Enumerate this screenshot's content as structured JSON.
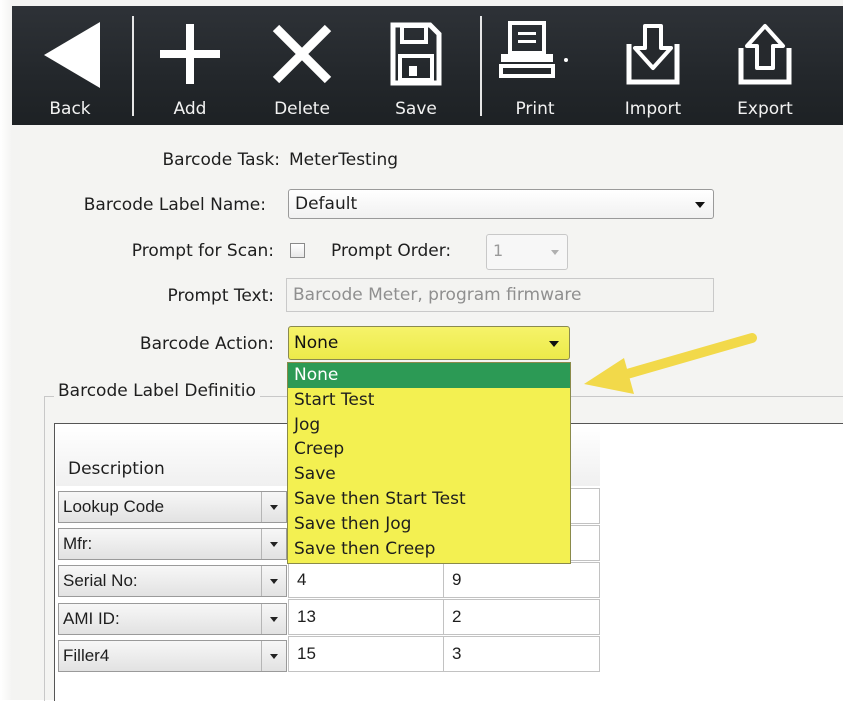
{
  "toolbar": {
    "back_label": "Back",
    "add_label": "Add",
    "delete_label": "Delete",
    "save_label": "Save",
    "print_label": "Print",
    "import_label": "Import",
    "export_label": "Export"
  },
  "form": {
    "task_label": "Barcode Task:",
    "task_value": "MeterTesting",
    "label_name_label": "Barcode Label Name:",
    "label_name_value": "Default",
    "prompt_scan_label": "Prompt for Scan:",
    "prompt_scan_checked": false,
    "prompt_order_label": "Prompt Order:",
    "prompt_order_value": "1",
    "prompt_text_label": "Prompt Text:",
    "prompt_text_value": "Barcode Meter, program firmware",
    "action_label": "Barcode Action:",
    "action_value": "None"
  },
  "action_options": [
    "None",
    "Start Test",
    "Jog",
    "Creep",
    "Save",
    "Save then Start Test",
    "Save then Jog",
    "Save then Creep"
  ],
  "action_selected_index": 0,
  "definition": {
    "group_title": "Barcode Label Definitio",
    "column_description": "Description",
    "rows": [
      {
        "description": "Lookup Code",
        "col2": "",
        "col3": ""
      },
      {
        "description": "Mfr:",
        "col2": "",
        "col3": ""
      },
      {
        "description": "Serial No:",
        "col2": "4",
        "col3": "9"
      },
      {
        "description": "AMI ID:",
        "col2": "13",
        "col3": "2"
      },
      {
        "description": "Filler4",
        "col2": "15",
        "col3": "3"
      }
    ]
  },
  "colors": {
    "toolbar_bg": "#26292d",
    "highlight_yellow": "#f3f051",
    "selected_green": "#2c9a55",
    "annotation_arrow": "#f2d94a"
  }
}
